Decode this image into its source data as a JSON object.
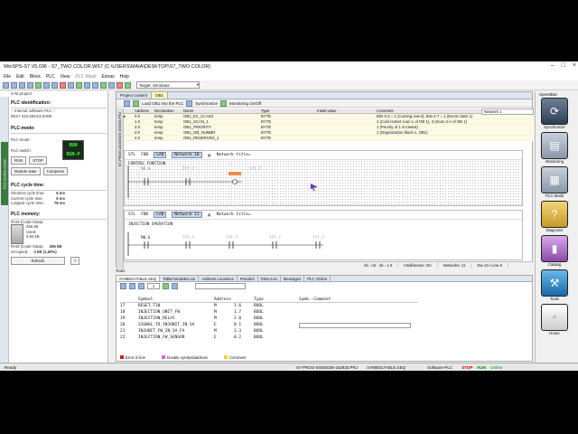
{
  "window": {
    "title": "WinSPS-S7 V5.036 - S7_TWO COLOR.WS7 (C:\\USERS\\MAIA\\DESKTOP\\S7_TWO COLOR)"
  },
  "menu": [
    "File",
    "Edit",
    "Block",
    "PLC",
    "View",
    "PLC Mask",
    "Extras",
    "Help"
  ],
  "toolbar": {
    "target_label": "Target: Simulator"
  },
  "left": {
    "header": "S-M project",
    "vtab_label": "PLC-control-center",
    "plc_id_title": "PLC identification:",
    "plc_id_lines": [
      "-- Internal software PLC --",
      "6ES7 315-2EH13-0AB0"
    ],
    "plc_mode_title": "PLC-mode:",
    "plc_mode_label": "PLC-mode:",
    "plc_switch_label": "PLC-switch:",
    "run_text": "RUN",
    "runp_text": "RUN-P",
    "run_btn": "RUN",
    "stop_btn": "STOP",
    "module_state_btn": "Module state",
    "compress_btn": "Compress",
    "cycle_title": "PLC cycle time:",
    "cycle_rows": [
      [
        "Shortest cycle time:",
        "6 ms"
      ],
      [
        "Current cycle time:",
        "6 ms"
      ],
      [
        "Longest cycle time:",
        "78 ms"
      ]
    ],
    "memory_title": "PLC memory:",
    "ram_label": "RAM (Code+Data):",
    "ram_total": "255 kB",
    "used_label": "Used:",
    "used_value": "3,84 kB",
    "ram_value2": "255 kB",
    "occupied_label": "Occupied:",
    "occupied_value": "3 kB (1,50%)",
    "refresh_btn": "Refresh",
    "help_btn": "?"
  },
  "editor": {
    "tabs": [
      "Project content",
      "OB1"
    ],
    "tb_load": "Load OB1 into the PLC",
    "tb_sync": "Synchronize",
    "tb_monitor": "Monitoring On/Off",
    "network_title_box": "Network 1",
    "var_headers": [
      "Address",
      "Declaration",
      "Name",
      "Type",
      "Initial value",
      "Comment"
    ],
    "var_rows": [
      [
        "0.0",
        "temp",
        "OB1_EV_CLASS",
        "BYTE",
        "",
        "Bits 0-3 = 1 (Coming event), Bits 4-7 = 1 (Event class 1)"
      ],
      [
        "1.0",
        "temp",
        "OB1_SCAN_1",
        "BYTE",
        "",
        "1 (Cold restart scan 1 of OB 1), 3 (Scan 2-n of OB 1)"
      ],
      [
        "2.0",
        "temp",
        "OB1_PRIORITY",
        "BYTE",
        "",
        "1 (Priority of 1 is lowest)"
      ],
      [
        "3.0",
        "temp",
        "OB1_OB_NUMBR",
        "BYTE",
        "",
        "1 (Organization block 1, OB1)"
      ],
      [
        "4.0",
        "temp",
        "OB1_RESERVED_1",
        "BYTE",
        "",
        ""
      ]
    ],
    "vstrip_label": "S7-PROG-04092026 163933.PRJ",
    "net1": {
      "lang1": "STL",
      "lang2": "FBD",
      "lang3": "LAD",
      "badge": "Network 10",
      "title_prompt": "Network title=",
      "comment": "CONTROL FUNCTION",
      "contact1": "M0.0",
      "contact2": "???.?",
      "coil": "???.?"
    },
    "net2": {
      "lang1": "STL",
      "lang2": "FBD",
      "lang3": "LAD",
      "badge": "Network 11",
      "title_prompt": "Network title=",
      "comment": "INJECTION OPERATION",
      "contacts": [
        "M0.6",
        "???.?",
        "???.?",
        "???.?",
        "???.?"
      ]
    },
    "status": [
      "nb : nb : nb - 1.0",
      "IntelliSense: On",
      "Networks: 11",
      "Nw 10 / Line 8"
    ]
  },
  "bottom": {
    "tools_label": "Tools",
    "tabs": [
      "SYMBOLTABLE.SEQ",
      "Table/Variables.var",
      "Address Locations",
      "Protokol",
      "ToDo-List",
      "Messages",
      "PLC Online"
    ],
    "headers": [
      "",
      "Symbol",
      "Address",
      "Type",
      "Symb.-Comment"
    ],
    "rows": [
      [
        "17",
        "RESET_T10",
        "M",
        "1.6",
        "BOOL"
      ],
      [
        "18",
        "INJECTION_UNIT_FW",
        "M",
        "1.7",
        "BOOL"
      ],
      [
        "19",
        "INJECTION_RELAY",
        "M",
        "2.0",
        "BOOL"
      ],
      [
        "20",
        "SIGNAL_TO_INJUNIT_IN_SA",
        "E",
        "0.1",
        "BOOL"
      ],
      [
        "21",
        "INJUNIT_FW_IN_SA_FA",
        "M",
        "2.3",
        "BOOL"
      ],
      [
        "22",
        "INJECTION_FW_SENSOR",
        "E",
        "0.2",
        "BOOL"
      ]
    ],
    "page_num": "1",
    "legend": [
      {
        "label": "Error in line",
        "color": "#d02020"
      },
      {
        "label": "Double symbol/address",
        "color": "#e060e0"
      },
      {
        "label": "Comment",
        "color": "#f0d040"
      }
    ]
  },
  "rside": {
    "title": "SpeedBar",
    "items": [
      {
        "label": "Synchronize",
        "icon": "sync-icon"
      },
      {
        "label": "Monitoring",
        "icon": "monitor-icon"
      },
      {
        "label": "PLC-Mask",
        "icon": "plc-mask-icon"
      },
      {
        "label": "Diagnosis",
        "icon": "diagnosis-icon"
      },
      {
        "label": "Catalog",
        "icon": "catalog-icon"
      },
      {
        "label": "Tools",
        "icon": "tools-icon"
      },
      {
        "label": "Home",
        "icon": "home-icon"
      }
    ],
    "vtab_label": "Hardware-Config"
  },
  "statusbar": {
    "ready": "Ready",
    "file": "S7-PROG-04092026-163933.PRJ",
    "symtable": "SYMBOLTABLE.SEQ",
    "software": "Software-PLC",
    "stop": "STOP",
    "run": "RUN",
    "online": "Online"
  }
}
